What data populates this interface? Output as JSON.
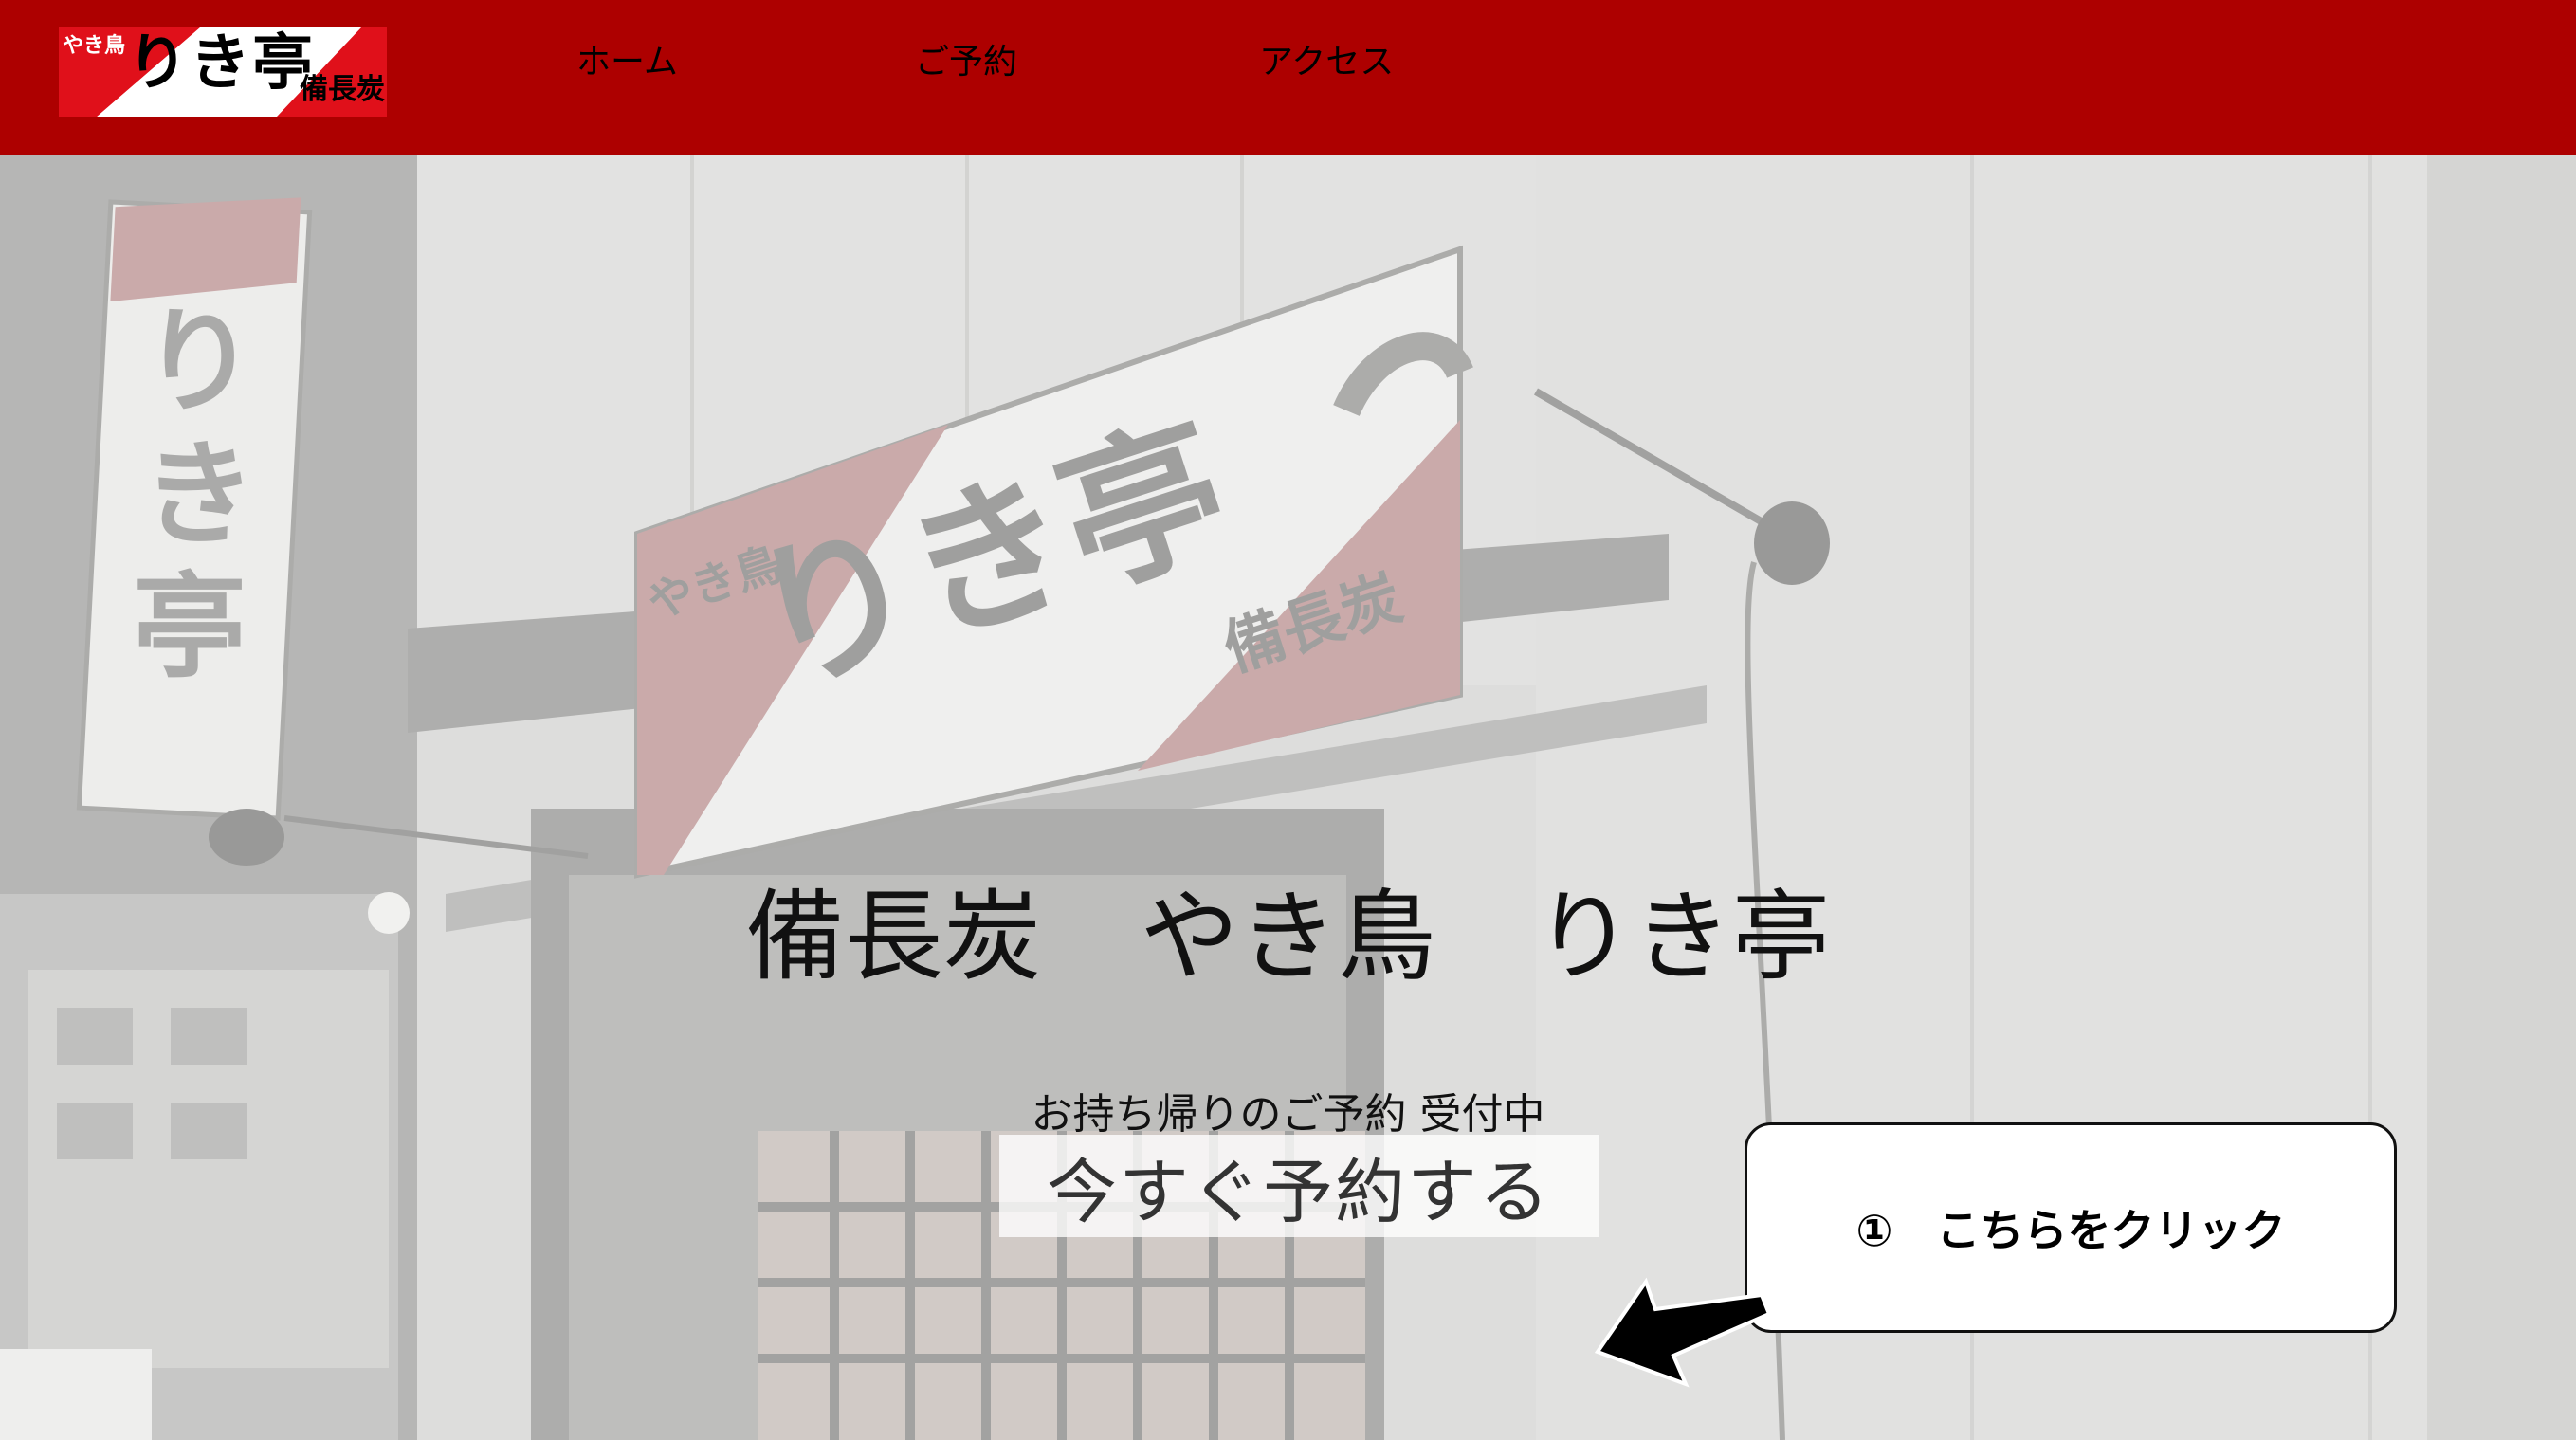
{
  "header": {
    "logo": {
      "small_text": "やき鳥",
      "main_text": "りき亭",
      "sub_text": "備長炭"
    },
    "nav": [
      {
        "label": "ホーム"
      },
      {
        "label": "ご予約"
      },
      {
        "label": "アクセス"
      }
    ]
  },
  "hero": {
    "title": "備長炭　やき鳥　りき亭",
    "subtitle": "お持ち帰りのご予約 受付中",
    "reserve_button": "今すぐ予約する"
  },
  "annotation": {
    "callout_text": "①　こちらをクリック"
  },
  "colors": {
    "header_bg": "#ad0000",
    "logo_red": "#e0101a",
    "overlay": "#e6e6e4"
  }
}
